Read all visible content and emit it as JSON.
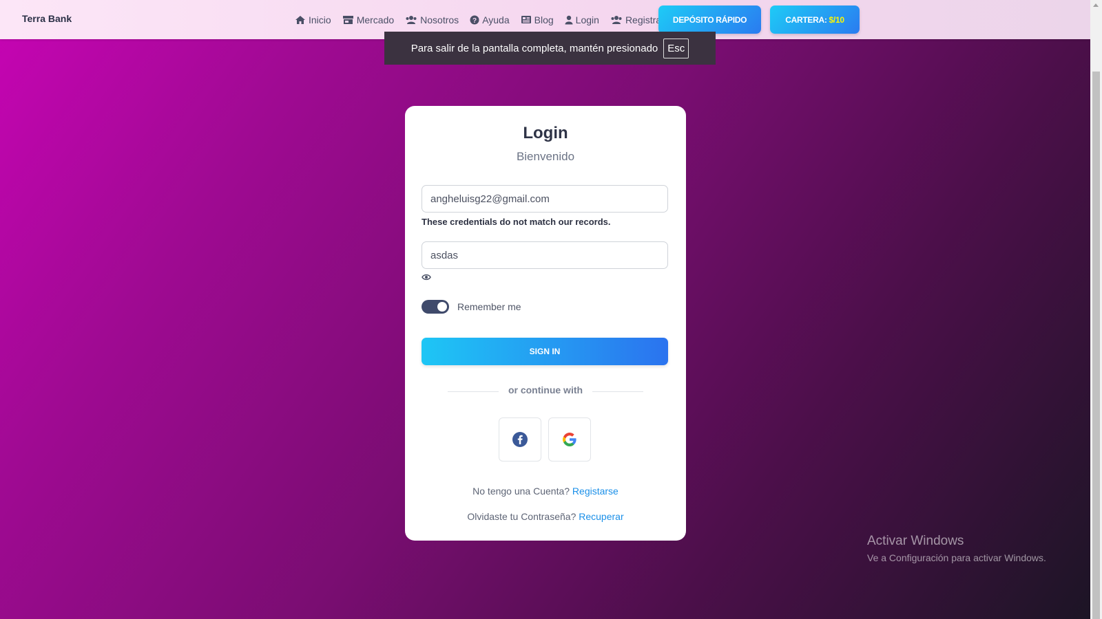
{
  "navbar": {
    "brand": "Terra Bank",
    "links": [
      {
        "label": "Inicio",
        "icon": "home-icon"
      },
      {
        "label": "Mercado",
        "icon": "store-icon"
      },
      {
        "label": "Nosotros",
        "icon": "users-icon"
      },
      {
        "label": "Ayuda",
        "icon": "question-circle-icon"
      },
      {
        "label": "Blog",
        "icon": "newspaper-icon"
      },
      {
        "label": "Login",
        "icon": "user-icon"
      },
      {
        "label": "Registrarse",
        "icon": "users-icon"
      }
    ],
    "deposit_label": "DEPÓSITO RÁPIDO",
    "wallet_label": "CARTERA:",
    "wallet_amount": "$/10"
  },
  "fullscreen_banner": {
    "text": "Para salir de la pantalla completa, mantén presionado",
    "key": "Esc"
  },
  "login": {
    "title": "Login",
    "subtitle": "Bienvenido",
    "email_value": "angheluisg22@gmail.com",
    "error_message": "These credentials do not match our records.",
    "password_value": "asdas",
    "remember_label": "Remember me",
    "remember_checked": true,
    "signin_label": "SIGN IN",
    "divider_text": "or continue with",
    "no_account_text": "No tengo una Cuenta?",
    "register_link": "Registarse",
    "forgot_text": "Olvidaste tu Contraseña?",
    "recover_link": "Recuperar"
  },
  "windows_watermark": {
    "title": "Activar Windows",
    "subtitle": "Ve a Configuración para activar Windows."
  },
  "colors": {
    "accent_blue": "#2a7bf0",
    "accent_cyan": "#1ecbf6",
    "wallet_amount": "#fff700",
    "background_magenta": "#c704b4"
  }
}
